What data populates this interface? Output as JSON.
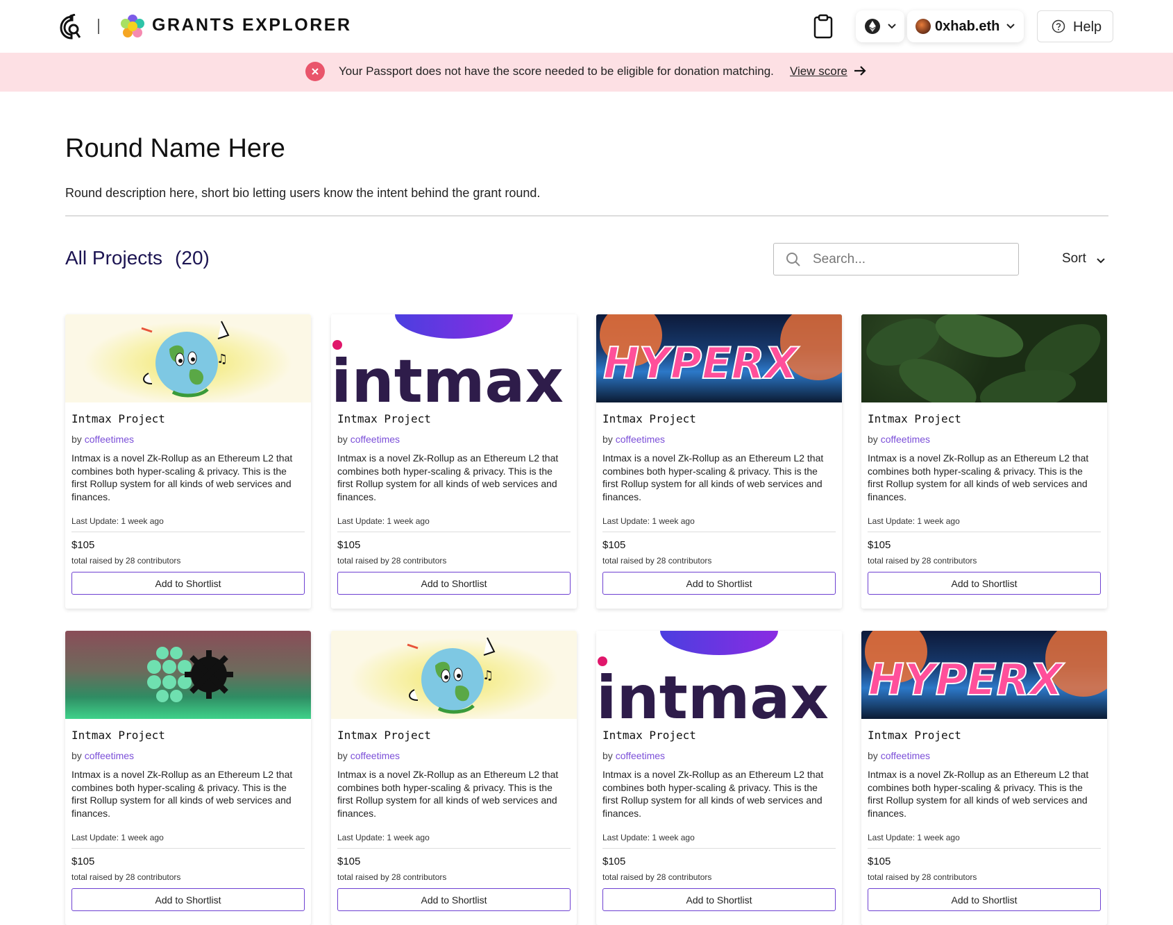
{
  "header": {
    "brand": "GRANTS EXPLORER",
    "account_name": "0xhab.eth",
    "help_label": "Help"
  },
  "banner": {
    "message": "Your Passport does not have the score needed to be eligible for donation matching.",
    "link_label": "View score",
    "accent": "#e9556b",
    "background": "#fde0e4"
  },
  "round": {
    "title": "Round Name Here",
    "description": "Round description here, short bio letting users know the intent behind the grant round."
  },
  "projects": {
    "heading": "All Projects",
    "count_label": "(20)",
    "search_placeholder": "Search...",
    "sort_label": "Sort"
  },
  "cards": [
    {
      "image": "globe",
      "title": "Intmax Project",
      "by": "by",
      "owner": "coffeetimes",
      "description": "Intmax is a novel Zk-Rollup as an Ethereum L2 that combines both hyper-scaling & privacy. This is the first Rollup system for all kinds of web services and finances.",
      "updated": "Last Update: 1 week ago",
      "amount": "$105",
      "raised": "total raised by 28 contributors",
      "button": "Add to Shortlist"
    },
    {
      "image": "intmax",
      "title": "Intmax Project",
      "by": "by",
      "owner": "coffeetimes",
      "description": "Intmax is a novel Zk-Rollup as an Ethereum L2 that combines both hyper-scaling & privacy. This is the first Rollup system for all kinds of web services and finances.",
      "updated": "Last Update: 1 week ago",
      "amount": "$105",
      "raised": "total raised by 28 contributors",
      "button": "Add to Shortlist"
    },
    {
      "image": "hyperx",
      "title": "Intmax Project",
      "by": "by",
      "owner": "coffeetimes",
      "description": "Intmax is a novel Zk-Rollup as an Ethereum L2 that combines both hyper-scaling & privacy. This is the first Rollup system for all kinds of web services and finances.",
      "updated": "Last Update: 1 week ago",
      "amount": "$105",
      "raised": "total raised by 28 contributors",
      "button": "Add to Shortlist"
    },
    {
      "image": "leaves",
      "title": "Intmax Project",
      "by": "by",
      "owner": "coffeetimes",
      "description": "Intmax is a novel Zk-Rollup as an Ethereum L2 that combines both hyper-scaling & privacy. This is the first Rollup system for all kinds of web services and finances.",
      "updated": "Last Update: 1 week ago",
      "amount": "$105",
      "raised": "total raised by 28 contributors",
      "button": "Add to Shortlist"
    },
    {
      "image": "gear",
      "title": "Intmax Project",
      "by": "by",
      "owner": "coffeetimes",
      "description": "Intmax is a novel Zk-Rollup as an Ethereum L2 that combines both hyper-scaling & privacy. This is the first Rollup system for all kinds of web services and finances.",
      "updated": "Last Update: 1 week ago",
      "amount": "$105",
      "raised": "total raised by 28 contributors",
      "button": "Add to Shortlist"
    },
    {
      "image": "globe",
      "title": "Intmax Project",
      "by": "by",
      "owner": "coffeetimes",
      "description": "Intmax is a novel Zk-Rollup as an Ethereum L2 that combines both hyper-scaling & privacy. This is the first Rollup system for all kinds of web services and finances.",
      "updated": "Last Update: 1 week ago",
      "amount": "$105",
      "raised": "total raised by 28 contributors",
      "button": "Add to Shortlist"
    },
    {
      "image": "intmax",
      "title": "Intmax Project",
      "by": "by",
      "owner": "coffeetimes",
      "description": "Intmax is a novel Zk-Rollup as an Ethereum L2 that combines both hyper-scaling & privacy. This is the first Rollup system for all kinds of web services and finances.",
      "updated": "Last Update: 1 week ago",
      "amount": "$105",
      "raised": "total raised by 28 contributors",
      "button": "Add to Shortlist"
    },
    {
      "image": "hyperx",
      "title": "Intmax Project",
      "by": "by",
      "owner": "coffeetimes",
      "description": "Intmax is a novel Zk-Rollup as an Ethereum L2 that combines both hyper-scaling & privacy. This is the first Rollup system for all kinds of web services and finances.",
      "updated": "Last Update: 1 week ago",
      "amount": "$105",
      "raised": "total raised by 28 contributors",
      "button": "Add to Shortlist"
    }
  ],
  "logos": {
    "intmax": "intmax",
    "hyperx": "HYPERX"
  },
  "colors": {
    "accent": "#6c3fd1",
    "owner_link": "#7b4fd8",
    "heading": "#1c1452"
  }
}
